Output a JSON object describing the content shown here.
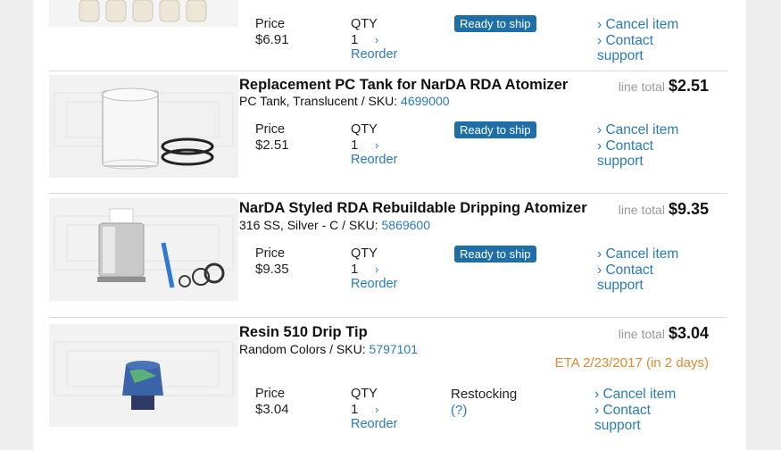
{
  "items": [
    {
      "name": "",
      "variant": "",
      "sku": "",
      "line_total_label": "",
      "line_total": "",
      "price_label": "Price",
      "price": "$6.91",
      "qty_label": "QTY",
      "qty": "1",
      "qty_chevron": "›",
      "reorder_label": "Reorder",
      "status": "Ready to ship",
      "cancel_label": "› Cancel item",
      "contact_label": "› Contact",
      "support_label": "support"
    },
    {
      "name": "Replacement PC Tank for NarDA RDA Atomizer",
      "variant": "PC Tank, Translucent / SKU: ",
      "sku": "4699000",
      "line_total_label": "line total",
      "line_total": "$2.51",
      "price_label": "Price",
      "price": "$2.51",
      "qty_label": "QTY",
      "qty": "1",
      "qty_chevron": "›",
      "reorder_label": "Reorder",
      "status": "Ready to ship",
      "cancel_label": "› Cancel item",
      "contact_label": "› Contact",
      "support_label": "support"
    },
    {
      "name": "NarDA Styled RDA Rebuildable Dripping Atomizer",
      "variant": "316 SS, Silver - C / SKU: ",
      "sku": "5869600",
      "line_total_label": "line total",
      "line_total": "$9.35",
      "price_label": "Price",
      "price": "$9.35",
      "qty_label": "QTY",
      "qty": "1",
      "qty_chevron": "›",
      "reorder_label": "Reorder",
      "status": "Ready to ship",
      "cancel_label": "› Cancel item",
      "contact_label": "› Contact",
      "support_label": "support"
    },
    {
      "name": "Resin 510 Drip Tip",
      "variant": "Random Colors / SKU: ",
      "sku": "5797101",
      "line_total_label": "line total",
      "line_total": "$3.04",
      "eta": "ETA 2/23/2017 (in 2 days)",
      "price_label": "Price",
      "price": "$3.04",
      "qty_label": "QTY",
      "qty": "1",
      "qty_chevron": "›",
      "reorder_label": "Reorder",
      "status": "Restocking",
      "status_help": "(?)",
      "cancel_label": "› Cancel item",
      "contact_label": "› Contact",
      "support_label": "support"
    }
  ],
  "colors": {
    "link": "#2a7bb5",
    "badge": "#1e6fa8",
    "eta": "#e08a2e",
    "muted": "#9a9a9a"
  },
  "icons": [
    "chevron-right-icon"
  ]
}
